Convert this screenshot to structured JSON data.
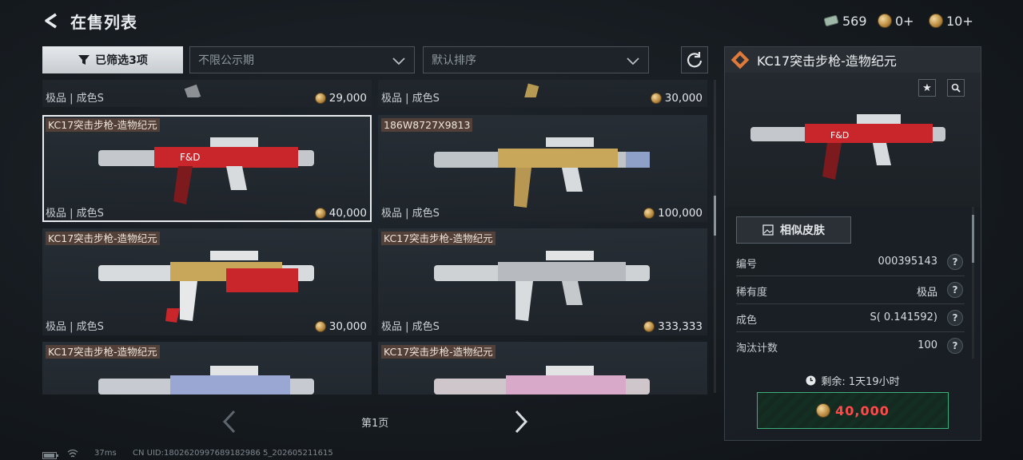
{
  "header": {
    "title": "在售列表",
    "currencies": [
      {
        "icon": "ticket-icon",
        "value": "569"
      },
      {
        "icon": "coin-icon",
        "value": "0+"
      },
      {
        "icon": "coin-icon",
        "value": "10+"
      }
    ]
  },
  "filters": {
    "filter_button_label": "已筛选3项",
    "period_dropdown": "不限公示期",
    "sort_dropdown": "默认排序"
  },
  "listings": [
    {
      "name": "",
      "meta": "极品 | 成色S",
      "price": "29,000"
    },
    {
      "name": "",
      "meta": "极品 | 成色S",
      "price": "30,000"
    },
    {
      "name": "KC17突击步枪-造物纪元",
      "meta": "极品 | 成色S",
      "price": "40,000",
      "selected": true
    },
    {
      "name": "186W8727X9813",
      "meta": "极品 | 成色S",
      "price": "100,000"
    },
    {
      "name": "KC17突击步枪-造物纪元",
      "meta": "极品 | 成色S",
      "price": "30,000"
    },
    {
      "name": "KC17突击步枪-造物纪元",
      "meta": "极品 | 成色S",
      "price": "333,333"
    },
    {
      "name": "KC17突击步枪-造物纪元",
      "meta": "",
      "price": ""
    },
    {
      "name": "KC17突击步枪-造物纪元",
      "meta": "",
      "price": ""
    }
  ],
  "pagination": {
    "label": "第1页"
  },
  "footer": {
    "ping": "37ms",
    "uid": "CN UID:1802620997689182986 5_202605211615"
  },
  "detail": {
    "title": "KC17突击步枪-造物纪元",
    "similar_button": "相似皮肤",
    "attributes": [
      {
        "key": "编号",
        "value": "000395143"
      },
      {
        "key": "稀有度",
        "value": "极品"
      },
      {
        "key": "成色",
        "value": "S( 0.141592)"
      },
      {
        "key": "淘汰计数",
        "value": "100"
      }
    ],
    "time_remaining": "剩余: 1天19小时",
    "buy_price": "40,000"
  },
  "colors": {
    "accent_green": "#3fb07a",
    "price_red": "#ff4a4a",
    "selected_outline": "#e9ecef"
  }
}
